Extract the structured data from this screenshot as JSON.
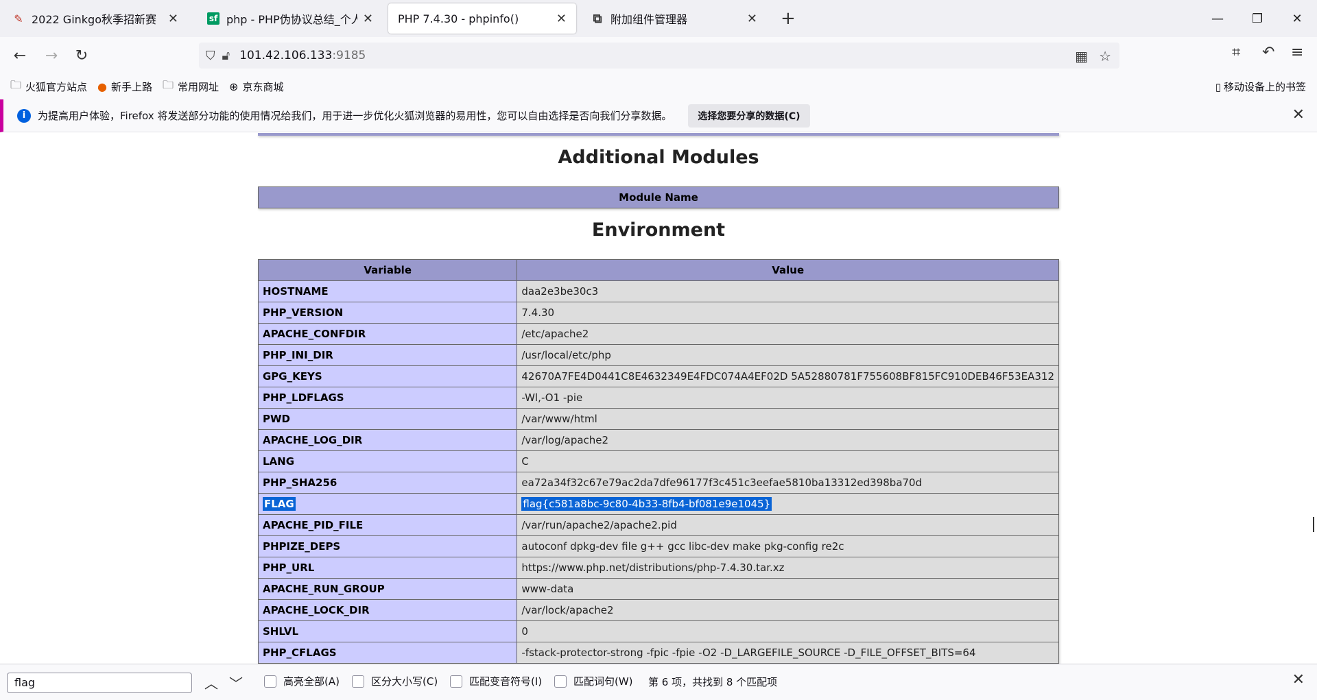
{
  "tabs": [
    {
      "title": "2022 Ginkgo秋季招新赛",
      "favicon": "ginkgo-icon"
    },
    {
      "title": "php - PHP伪协议总结_个人文章",
      "favicon": "sf-icon"
    },
    {
      "title": "PHP 7.4.30 - phpinfo()",
      "favicon": "none",
      "active": true
    },
    {
      "title": "附加组件管理器",
      "favicon": "puzzle-icon"
    }
  ],
  "url": {
    "host": "101.42.106.133",
    "port": ":9185"
  },
  "bookmarks": [
    {
      "label": "火狐官方站点",
      "icon": "folder-icon"
    },
    {
      "label": "新手上路",
      "icon": "firefox-icon"
    },
    {
      "label": "常用网址",
      "icon": "folder-icon"
    },
    {
      "label": "京东商城",
      "icon": "globe-icon"
    }
  ],
  "mobile_bookmarks": "移动设备上的书签",
  "notification": {
    "message": "为提高用户体验，Firefox 将发送部分功能的使用情况给我们，用于进一步优化火狐浏览器的易用性，您可以自由选择是否向我们分享数据。",
    "button": "选择您要分享的数据(C)"
  },
  "page": {
    "modules_heading": "Additional Modules",
    "modules_header": "Module Name",
    "env_heading": "Environment",
    "env_headers": [
      "Variable",
      "Value"
    ],
    "env_rows": [
      {
        "k": "HOSTNAME",
        "v": "daa2e3be30c3"
      },
      {
        "k": "PHP_VERSION",
        "v": "7.4.30"
      },
      {
        "k": "APACHE_CONFDIR",
        "v": "/etc/apache2"
      },
      {
        "k": "PHP_INI_DIR",
        "v": "/usr/local/etc/php"
      },
      {
        "k": "GPG_KEYS",
        "v": "42670A7FE4D0441C8E4632349E4FDC074A4EF02D 5A52880781F755608BF815FC910DEB46F53EA312"
      },
      {
        "k": "PHP_LDFLAGS",
        "v": "-Wl,-O1 -pie"
      },
      {
        "k": "PWD",
        "v": "/var/www/html"
      },
      {
        "k": "APACHE_LOG_DIR",
        "v": "/var/log/apache2"
      },
      {
        "k": "LANG",
        "v": "C"
      },
      {
        "k": "PHP_SHA256",
        "v": "ea72a34f32c67e79ac2da7dfe96177f3c451c3eefae5810ba13312ed398ba70d"
      },
      {
        "k": "FLAG",
        "v": "flag{c581a8bc-9c80-4b33-8fb4-bf081e9e1045}",
        "highlight": true
      },
      {
        "k": "APACHE_PID_FILE",
        "v": "/var/run/apache2/apache2.pid"
      },
      {
        "k": "PHPIZE_DEPS",
        "v": "autoconf dpkg-dev file g++ gcc libc-dev make pkg-config re2c"
      },
      {
        "k": "PHP_URL",
        "v": "https://www.php.net/distributions/php-7.4.30.tar.xz"
      },
      {
        "k": "APACHE_RUN_GROUP",
        "v": "www-data"
      },
      {
        "k": "APACHE_LOCK_DIR",
        "v": "/var/lock/apache2"
      },
      {
        "k": "SHLVL",
        "v": "0"
      },
      {
        "k": "PHP_CFLAGS",
        "v": "-fstack-protector-strong -fpic -fpie -O2 -D_LARGEFILE_SOURCE -D_FILE_OFFSET_BITS=64"
      }
    ]
  },
  "findbar": {
    "query": "flag",
    "highlight_all": "高亮全部(A)",
    "match_case": "区分大小写(C)",
    "match_diacritics": "匹配变音符号(I)",
    "whole_words": "匹配词句(W)",
    "status": "第 6 项，共找到 8 个匹配项"
  },
  "colors": {
    "php_header": "#9999cc",
    "php_key": "#ccccff",
    "php_value": "#dddddd",
    "selection": "#0a64d6",
    "notification_accent": "#c9009e"
  }
}
